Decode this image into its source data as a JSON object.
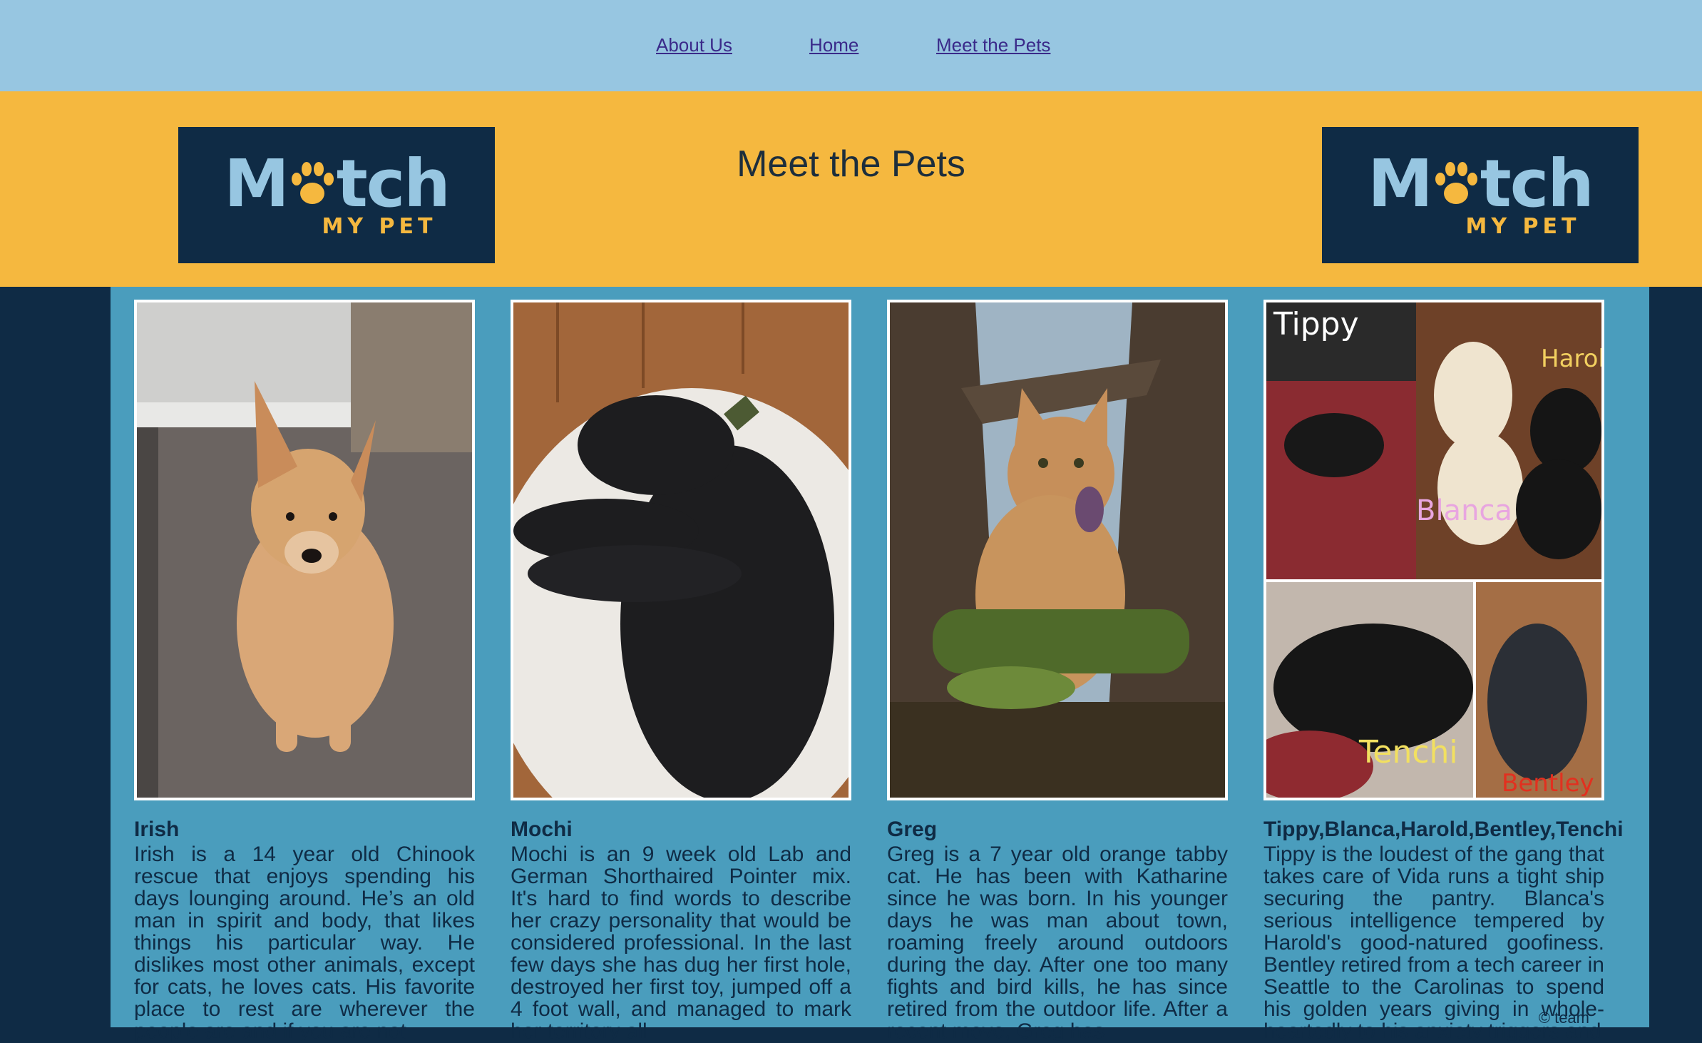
{
  "nav": {
    "about": "About Us",
    "home": "Home",
    "meet": "Meet the Pets"
  },
  "header": {
    "title": "Meet the Pets",
    "logo_word_start": "M",
    "logo_word_end": "tch",
    "logo_sub": "MY PET"
  },
  "pets": [
    {
      "name": "Irish",
      "description": "Irish is a 14 year old Chinook rescue that enjoys spending his days lounging around. He’s an old man in spirit and body, that likes things his particular way. He dislikes most other animals, except for cats, he loves cats. His favorite place to rest are wherever the people are and if you are not"
    },
    {
      "name": "Mochi",
      "description": "Mochi is an 9 week old Lab and German Shorthaired Pointer mix. It's hard to find words to describe her crazy personality that would be considered professional. In the last few days she has dug her first hole, destroyed her first toy, jumped off a 4 foot wall, and managed to mark her territory all"
    },
    {
      "name": "Greg",
      "description": "Greg is a 7 year old orange tabby cat. He has been with Katharine since he was born. In his younger days he was man about town, roaming freely around outdoors during the day. After one too many fights and bird kills, he has since retired from the outdoor life. After a recent move, Greg has"
    },
    {
      "name": "Tippy,Blanca,Harold,Bentley,Tenchi",
      "description": "Tippy is the loudest of the gang that takes care of Vida runs a tight ship securing the pantry. Blanca's serious intelligence tempered by Harold's good-natured goofiness. Bentley retired from a tech career in Seattle to the Carolinas to spend his golden years giving in whole-heartedly to his anxiety triggers and"
    }
  ],
  "collage_labels": {
    "tippy": "Tippy",
    "harold": "Harold",
    "blanca": "Blanca",
    "tenchi": "Tenchi",
    "bentley": "Bentley"
  },
  "footer": {
    "text": "© team"
  }
}
